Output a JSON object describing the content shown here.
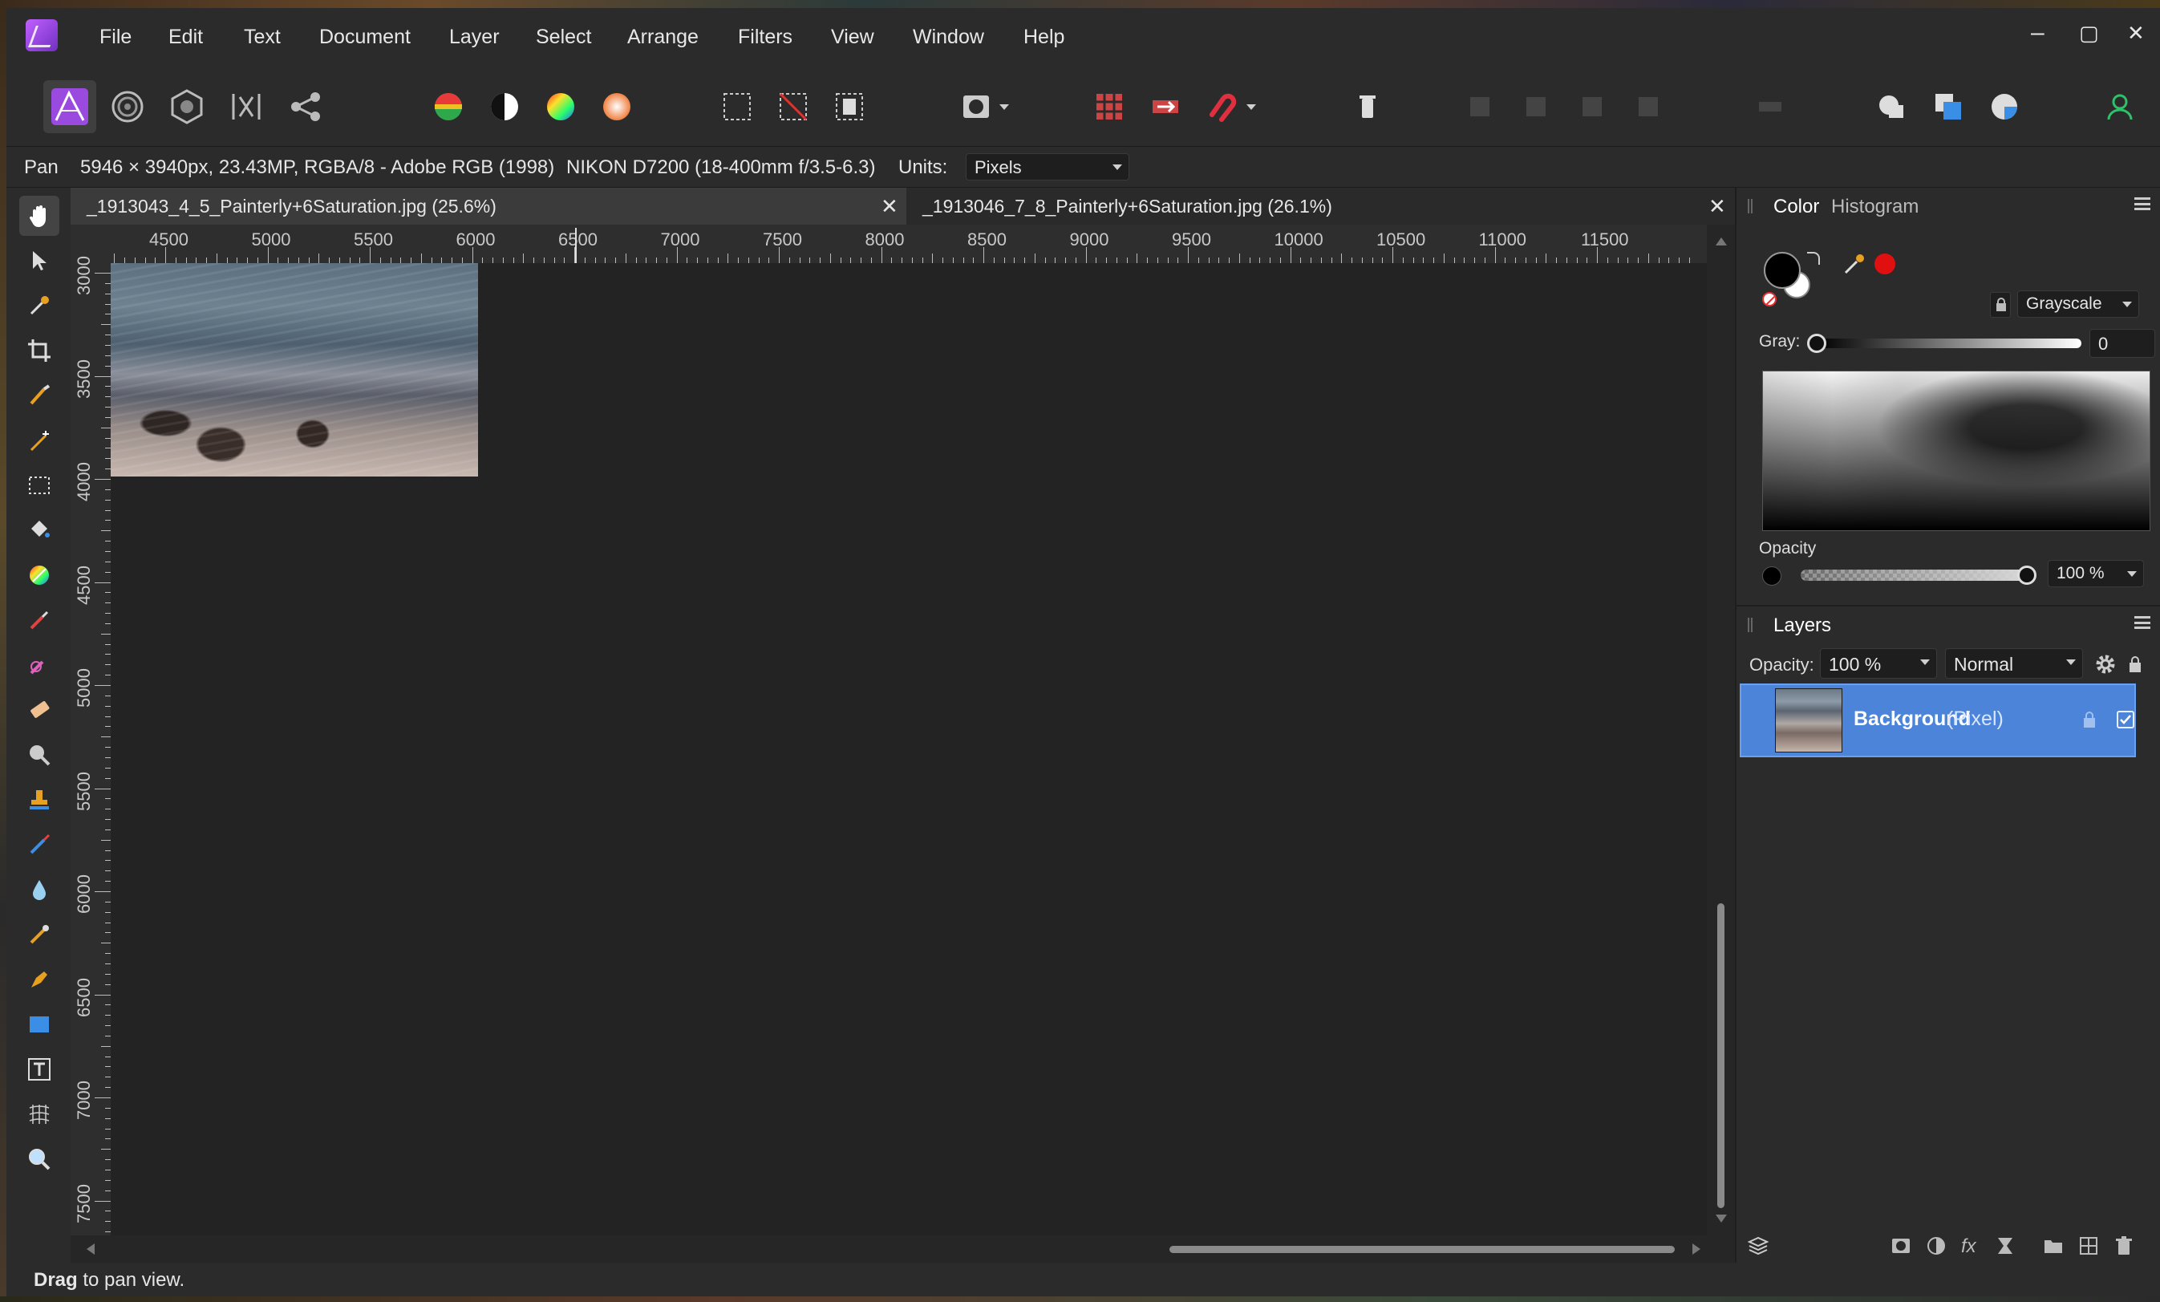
{
  "menubar": {
    "items": [
      "File",
      "Edit",
      "Text",
      "Document",
      "Layer",
      "Select",
      "Arrange",
      "Filters",
      "View",
      "Window",
      "Help"
    ]
  },
  "window_controls": {
    "minimize": "‒",
    "maximize": "▢",
    "close": "✕"
  },
  "context_bar": {
    "tool_name": "Pan",
    "doc_info": "5946 × 3940px, 23.43MP, RGBA/8 - Adobe RGB (1998)",
    "camera_info": "NIKON D7200 (18-400mm f/3.5-6.3)",
    "units_label": "Units:",
    "units_value": "Pixels"
  },
  "tabs": [
    {
      "title": "_1913043_4_5_Painterly+6Saturation.jpg (25.6%)",
      "active": true
    },
    {
      "title": "_1913046_7_8_Painterly+6Saturation.jpg (26.1%)",
      "active": false
    }
  ],
  "tab_close_glyph": "✕",
  "rulers": {
    "unit": "px",
    "horizontal": [
      "4500",
      "5000",
      "5500",
      "6000",
      "6500",
      "7000",
      "7500",
      "8000",
      "8500",
      "9000",
      "9500",
      "10000",
      "10500",
      "11000",
      "11500"
    ],
    "vertical": [
      "3000",
      "3500",
      "4000",
      "4500",
      "5000",
      "5500",
      "6000",
      "6500",
      "7000",
      "7500"
    ]
  },
  "color_panel": {
    "tabs": [
      "Color",
      "Histogram"
    ],
    "mode": "Grayscale",
    "gray_label": "Gray:",
    "gray_value": "0",
    "gray_position": 0,
    "opacity_label": "Opacity",
    "opacity_value": "100 %",
    "opacity_position": 1.0,
    "colors": {
      "fill": "#000000",
      "stroke": "#ffffff",
      "picker_swatch": "#e01010"
    }
  },
  "layers_panel": {
    "title": "Layers",
    "opacity_label": "Opacity:",
    "opacity_value": "100 %",
    "blend_mode": "Normal",
    "layers": [
      {
        "name": "Background",
        "type": "(Pixel)",
        "selected": true,
        "visible": true
      }
    ]
  },
  "status": {
    "bold": "Drag",
    "rest": " to pan view."
  },
  "accent_color": "#4b84d8"
}
